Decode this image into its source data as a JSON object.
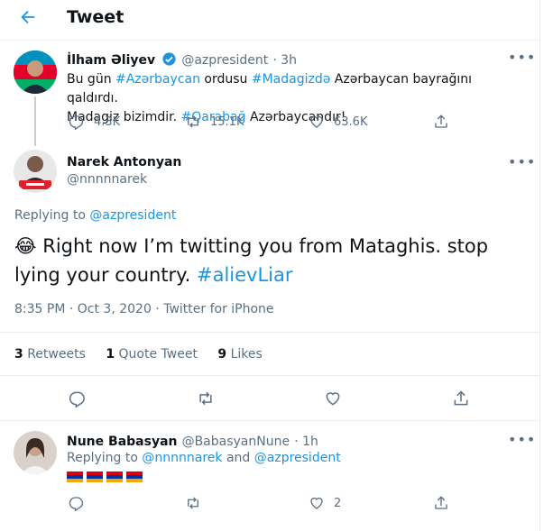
{
  "header": {
    "title": "Tweet"
  },
  "parent": {
    "name": "İlham Əliyev",
    "handle": "@azpresident",
    "time": "· 3h",
    "text_1": "Bu gün ",
    "tag_1": "#Azərbaycan",
    "text_2": " ordusu ",
    "tag_2": "#Madagizdə",
    "text_3": " Azərbaycan bayrağını qaldırdı.",
    "text_4": "Madagiz bizimdir. ",
    "tag_3": "#Qarabağ",
    "text_5": " Azərbaycandır!",
    "replies": "4.3K",
    "retweets": "15.1K",
    "likes": "63.6K"
  },
  "main": {
    "name": "Narek Antonyan",
    "handle": "@nnnnnarek",
    "replying_label": "Replying to ",
    "replying_to": "@azpresident",
    "emoji": "😂",
    "text_line1": " Right now I’m twitting you from Mataghis. stop",
    "text_line2": "lying your country. ",
    "hashtag": "#alievLiar",
    "meta": "8:35 PM · Oct 3, 2020 · Twitter for iPhone",
    "retweets_count": "3",
    "retweets_label": "Retweets",
    "quote_count": "1",
    "quote_label": "Quote Tweet",
    "likes_count": "9",
    "likes_label": "Likes"
  },
  "reply": {
    "name": "Nune Babasyan",
    "handle": "@BabasyanNune",
    "time": "· 1h",
    "replying_label": "Replying to ",
    "replying_to_1": "@nnnnnarek",
    "and": " and ",
    "replying_to_2": "@azpresident",
    "likes": "2"
  },
  "colors": {
    "accent": "#1b95e0",
    "muted": "#5b7083",
    "flag_red": "#d90012",
    "flag_blue": "#0033a0",
    "flag_orange": "#f2a800"
  },
  "icons": [
    "back-arrow-icon",
    "verified-icon",
    "more-icon",
    "reply-icon",
    "retweet-icon",
    "like-icon",
    "share-icon"
  ]
}
